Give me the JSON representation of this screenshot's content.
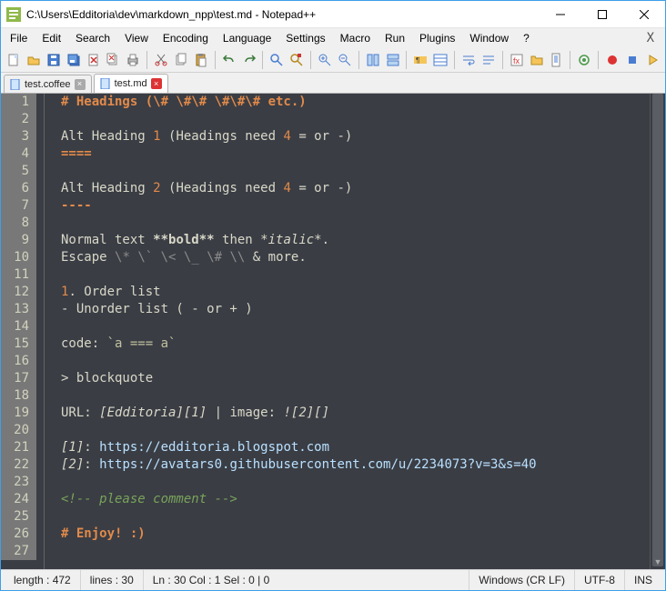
{
  "title": "C:\\Users\\Edditoria\\dev\\markdown_npp\\test.md - Notepad++",
  "menu": [
    "File",
    "Edit",
    "Search",
    "View",
    "Encoding",
    "Language",
    "Settings",
    "Macro",
    "Run",
    "Plugins",
    "Window",
    "?"
  ],
  "tabs": [
    {
      "label": "test.coffee",
      "active": false,
      "dirty": false
    },
    {
      "label": "test.md",
      "active": true,
      "dirty": true
    }
  ],
  "lines": [
    [
      {
        "cls": "c-hdr",
        "t": "# Headings (\\# \\#\\# \\#\\#\\# etc.)"
      }
    ],
    [],
    [
      {
        "t": "Alt Heading "
      },
      {
        "cls": "c-num",
        "t": "1"
      },
      {
        "t": " (Headings need "
      },
      {
        "cls": "c-num",
        "t": "4"
      },
      {
        "t": " = or -)"
      }
    ],
    [
      {
        "cls": "c-hdr",
        "t": "===="
      }
    ],
    [],
    [
      {
        "t": "Alt Heading "
      },
      {
        "cls": "c-num",
        "t": "2"
      },
      {
        "t": " (Headings need "
      },
      {
        "cls": "c-num",
        "t": "4"
      },
      {
        "t": " = or -)"
      }
    ],
    [
      {
        "cls": "c-hdr",
        "t": "----"
      }
    ],
    [],
    [
      {
        "t": "Normal text "
      },
      {
        "cls": "c-bold",
        "t": "**bold**"
      },
      {
        "t": " then "
      },
      {
        "cls": "c-ital",
        "t": "*italic*"
      },
      {
        "t": "."
      }
    ],
    [
      {
        "t": "Escape "
      },
      {
        "cls": "c-weak",
        "t": "\\*"
      },
      {
        "t": " "
      },
      {
        "cls": "c-weak",
        "t": "\\`"
      },
      {
        "t": " "
      },
      {
        "cls": "c-weak",
        "t": "\\<"
      },
      {
        "t": " "
      },
      {
        "cls": "c-weak",
        "t": "\\_"
      },
      {
        "t": " "
      },
      {
        "cls": "c-weak",
        "t": "\\#"
      },
      {
        "t": " "
      },
      {
        "cls": "c-weak",
        "t": "\\\\"
      },
      {
        "t": " & more."
      }
    ],
    [],
    [
      {
        "cls": "c-num",
        "t": "1"
      },
      {
        "t": ". Order list"
      }
    ],
    [
      {
        "t": "- Unorder list ( - or + )"
      }
    ],
    [],
    [
      {
        "t": "code: "
      },
      {
        "cls": "c-code",
        "t": "`a === a`"
      }
    ],
    [],
    [
      {
        "t": "> blockquote"
      }
    ],
    [],
    [
      {
        "t": "URL: "
      },
      {
        "cls": "c-ital",
        "t": "[Edditoria][1]"
      },
      {
        "t": " | image: "
      },
      {
        "cls": "c-ital",
        "t": "![2][]"
      }
    ],
    [],
    [
      {
        "cls": "c-ital",
        "t": "[1]"
      },
      {
        "t": ": "
      },
      {
        "cls": "c-link",
        "t": "https://edditoria.blogspot.com"
      }
    ],
    [
      {
        "cls": "c-ital",
        "t": "[2]"
      },
      {
        "t": ": "
      },
      {
        "cls": "c-link",
        "t": "https://avatars0.githubusercontent.com/u/2234073?v=3&s=40"
      }
    ],
    [],
    [
      {
        "cls": "c-green",
        "t": "<!-- please comment -->"
      }
    ],
    [],
    [
      {
        "cls": "c-hdr",
        "t": "# Enjoy! :)"
      }
    ],
    []
  ],
  "status": {
    "length": "length : 472",
    "lines": "lines : 30",
    "pos": "Ln : 30    Col : 1    Sel : 0 | 0",
    "eol": "Windows (CR LF)",
    "enc": "UTF-8",
    "ins": "INS"
  }
}
